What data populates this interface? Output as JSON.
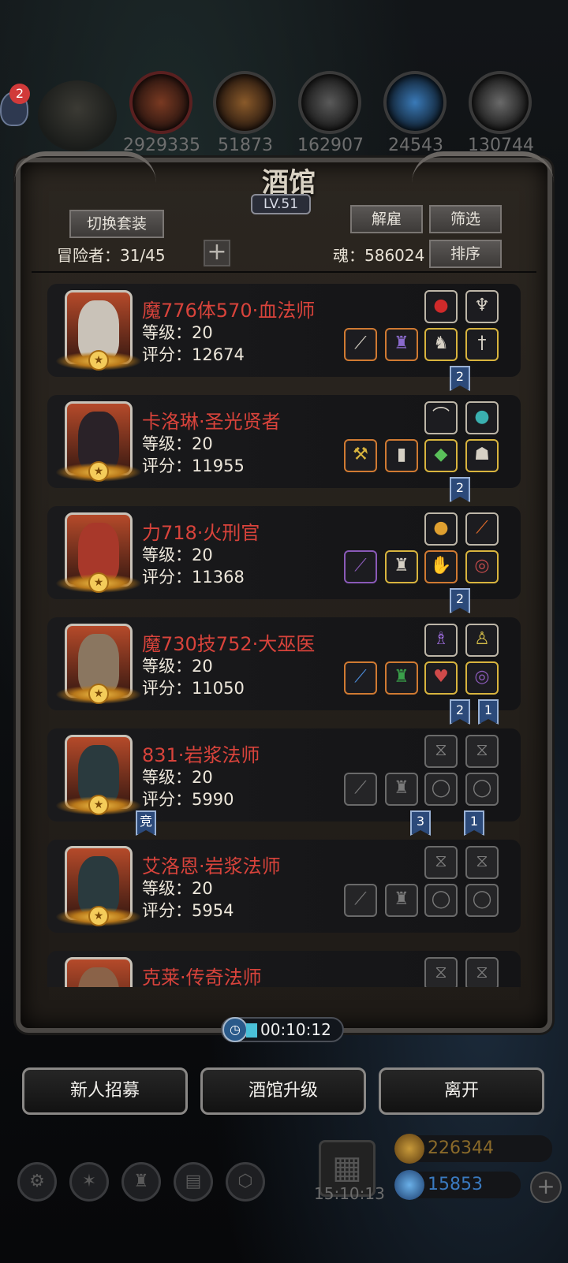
{
  "top_resources": {
    "notification_count": "2",
    "values": [
      "2929335",
      "51873",
      "162907",
      "24543",
      "130744"
    ]
  },
  "tavern": {
    "title": "酒馆",
    "level": "LV.51",
    "switch_outfit_label": "切换套装",
    "dismiss_label": "解雇",
    "filter_label": "筛选",
    "sort_label": "排序",
    "adventurers_label": "冒险者：31/45",
    "soul_label": "魂：586024"
  },
  "heroes": [
    {
      "name": "魔776体570·血法师",
      "level": "等级：20",
      "score": "评分：12674",
      "flags": [
        "2"
      ],
      "portrait_color": "#c9c2b8"
    },
    {
      "name": "卡洛琳·圣光贤者",
      "level": "等级：20",
      "score": "评分：11955",
      "flags": [
        "2"
      ],
      "portrait_color": "#2a2228"
    },
    {
      "name": "力718·火刑官",
      "level": "等级：20",
      "score": "评分：11368",
      "flags": [
        "2"
      ],
      "portrait_color": "#a8382a"
    },
    {
      "name": "魔730技752·大巫医",
      "level": "等级：20",
      "score": "评分：11050",
      "flags": [
        "2",
        "1"
      ],
      "portrait_color": "#8a7660"
    },
    {
      "name": "831·岩浆法师",
      "level": "等级：20",
      "score": "评分：5990",
      "left_tag": "竞",
      "flags": [
        "3",
        "1"
      ],
      "portrait_color": "#2a3a3e"
    },
    {
      "name": "艾洛恩·岩浆法师",
      "level": "等级：20",
      "score": "评分：5954",
      "portrait_color": "#2a3a3e"
    },
    {
      "name": "克莱·传奇法师",
      "portrait_color": "#8a6248"
    }
  ],
  "timer": "00:10:12",
  "buttons": {
    "recruit": "新人招募",
    "upgrade": "酒馆升级",
    "leave": "离开"
  },
  "hud": {
    "clock": "15:10:13",
    "gold": "226344",
    "gems": "15853"
  },
  "colors": {
    "hero_name": "#d8433b",
    "panel": "#2b2620",
    "gold": "#8a6a2a",
    "gems": "#3a7ac0"
  }
}
